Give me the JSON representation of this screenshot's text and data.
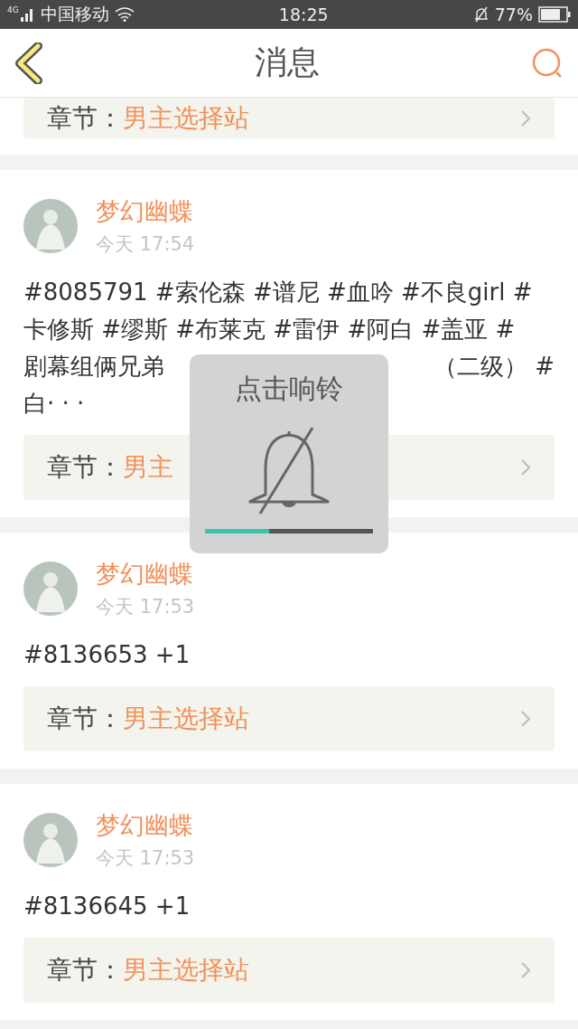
{
  "status_bar": {
    "network": "4G",
    "carrier": "中国移动",
    "time": "18:25",
    "battery": "77%"
  },
  "header": {
    "title": "消息"
  },
  "partial_post": {
    "chapter_label": "章节：",
    "chapter": "男主选择站"
  },
  "posts": [
    {
      "author": "梦幻幽蝶",
      "time": "今天 17:54",
      "lines": [
        [
          "#8085791 #索伦森 #谱尼 #血吟 #不良girl #"
        ],
        [
          "卡修斯 #缪斯 #布莱克 #雷伊 #阿白 #盖亚 #"
        ],
        [
          "剧幕组俩兄弟",
          "（二级） #"
        ],
        [
          "白· · ·"
        ]
      ],
      "chapter_label": "章节：",
      "chapter": "男主"
    },
    {
      "author": "梦幻幽蝶",
      "time": "今天 17:53",
      "lines": [
        [
          "#8136653 +1"
        ]
      ],
      "chapter_label": "章节：",
      "chapter": "男主选择站"
    },
    {
      "author": "梦幻幽蝶",
      "time": "今天 17:53",
      "lines": [
        [
          "#8136645 +1"
        ]
      ],
      "chapter_label": "章节：",
      "chapter": "男主选择站"
    }
  ],
  "toast": {
    "title": "点击响铃",
    "muted": true,
    "level": 0.38
  }
}
